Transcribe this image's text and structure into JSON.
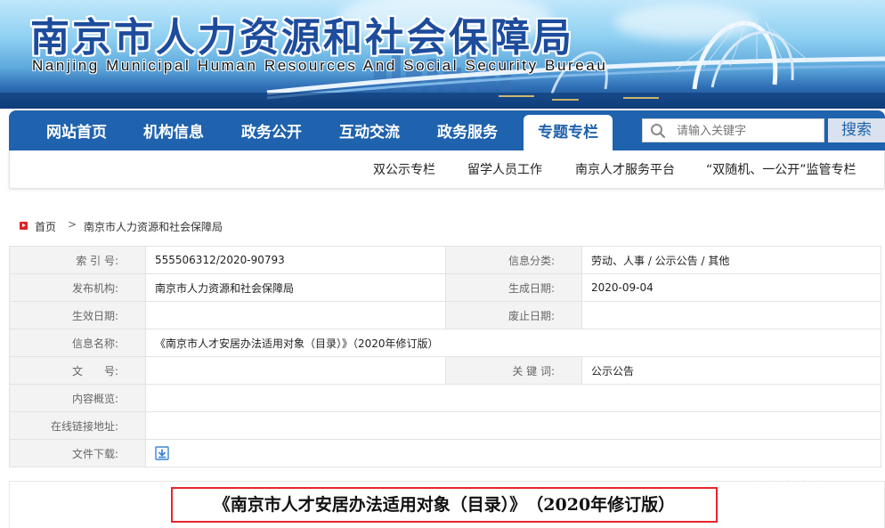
{
  "header": {
    "title": "南京市人力资源和社会保障局",
    "subtitle": "Nanjing Municipal Human Resources And Social Security Bureau"
  },
  "nav": {
    "items": [
      {
        "label": "网站首页"
      },
      {
        "label": "机构信息"
      },
      {
        "label": "政务公开"
      },
      {
        "label": "互动交流"
      },
      {
        "label": "政务服务"
      },
      {
        "label": "专题专栏",
        "active": true
      }
    ],
    "search_placeholder": "请输入关键字",
    "search_button": "搜索"
  },
  "subnav": {
    "items": [
      {
        "label": "双公示专栏"
      },
      {
        "label": "留学人员工作"
      },
      {
        "label": "南京人才服务平台"
      },
      {
        "label": "“双随机、一公开”监管专栏"
      }
    ]
  },
  "breadcrumb": {
    "home": "首页",
    "separator": ">",
    "current": "南京市人力资源和社会保障局"
  },
  "info": {
    "index_label": "索 引 号:",
    "index_value": "555506312/2020-90793",
    "category_label": "信息分类:",
    "category_value": "劳动、人事 / 公示公告 / 其他",
    "publisher_label": "发布机构:",
    "publisher_value": "南京市人力资源和社会保障局",
    "created_label": "生成日期:",
    "created_value": "2020-09-04",
    "effective_label": "生效日期:",
    "effective_value": "",
    "repeal_label": "废止日期:",
    "repeal_value": "",
    "name_label": "信息名称:",
    "name_value": "《南京市人才安居办法适用对象（目录）》（2020年修订版）",
    "docno_label": "文　　号:",
    "docno_value": "",
    "keywords_label": "关 键 词:",
    "keywords_value": "公示公告",
    "overview_label": "内容概览:",
    "overview_value": "",
    "link_label": "在线链接地址:",
    "link_value": "",
    "download_label": "文件下载:"
  },
  "article": {
    "title": "《南京市人才安居办法适用对象（目录）》　（2020年修订版）"
  },
  "colors": {
    "nav_blue": "#1f62ad",
    "title_blue": "#1d4c9c",
    "highlight_red": "#e6262d",
    "label_bg": "#f3f3f3"
  }
}
